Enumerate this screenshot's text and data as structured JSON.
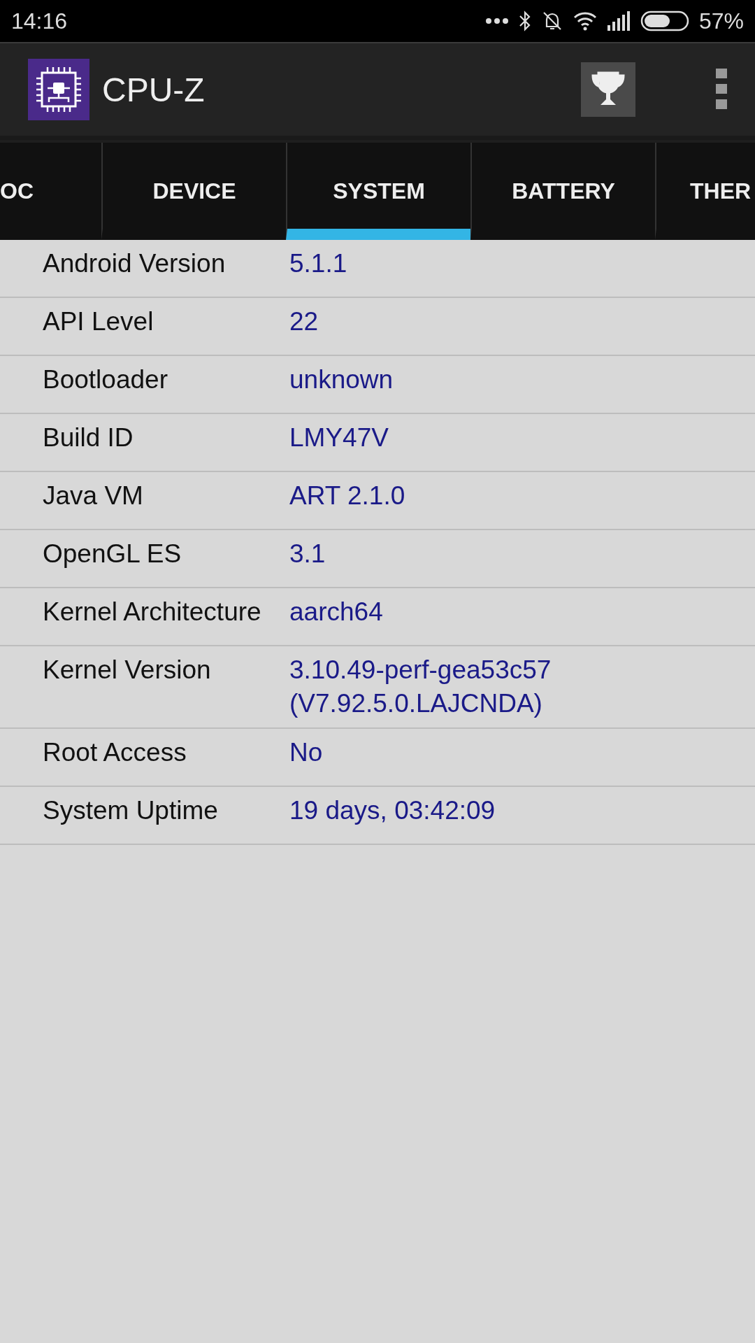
{
  "status_bar": {
    "time": "14:16",
    "battery": "57%"
  },
  "app_bar": {
    "title": "CPU-Z"
  },
  "tabs": [
    {
      "label": "OC",
      "selected": false
    },
    {
      "label": "DEVICE",
      "selected": false
    },
    {
      "label": "SYSTEM",
      "selected": true
    },
    {
      "label": "BATTERY",
      "selected": false
    },
    {
      "label": "THER",
      "selected": false
    }
  ],
  "rows": [
    {
      "label": "Android Version",
      "value": "5.1.1"
    },
    {
      "label": "API Level",
      "value": "22"
    },
    {
      "label": "Bootloader",
      "value": "unknown"
    },
    {
      "label": "Build ID",
      "value": "LMY47V"
    },
    {
      "label": "Java VM",
      "value": "ART 2.1.0"
    },
    {
      "label": "OpenGL ES",
      "value": "3.1"
    },
    {
      "label": "Kernel Architecture",
      "value": "aarch64"
    },
    {
      "label": "Kernel Version",
      "value": "3.10.49-perf-gea53c57\n(V7.92.5.0.LAJCNDA)"
    },
    {
      "label": "Root Access",
      "value": "No"
    },
    {
      "label": "System Uptime",
      "value": "19 days, 03:42:09"
    }
  ]
}
